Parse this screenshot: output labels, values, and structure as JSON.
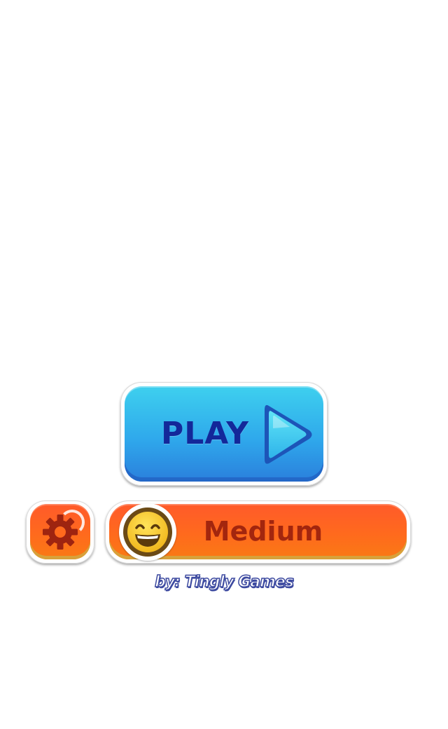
{
  "play_button": {
    "label": "PLAY",
    "icon": "play-triangle-icon",
    "colors": {
      "top": "#3ed0ee",
      "bottom": "#2a7fdc",
      "text": "#13289a"
    }
  },
  "settings_button": {
    "icon": "gear-icon",
    "colors": {
      "fill": "#ff6a1d",
      "gear": "#a3260e"
    }
  },
  "difficulty_button": {
    "label": "Medium",
    "icon": "smiley-face-icon",
    "colors": {
      "fill": "#ff6a1d",
      "text": "#a3260e",
      "face": "#f6c21c"
    }
  },
  "credit": {
    "text": "by: Tingly Games"
  }
}
